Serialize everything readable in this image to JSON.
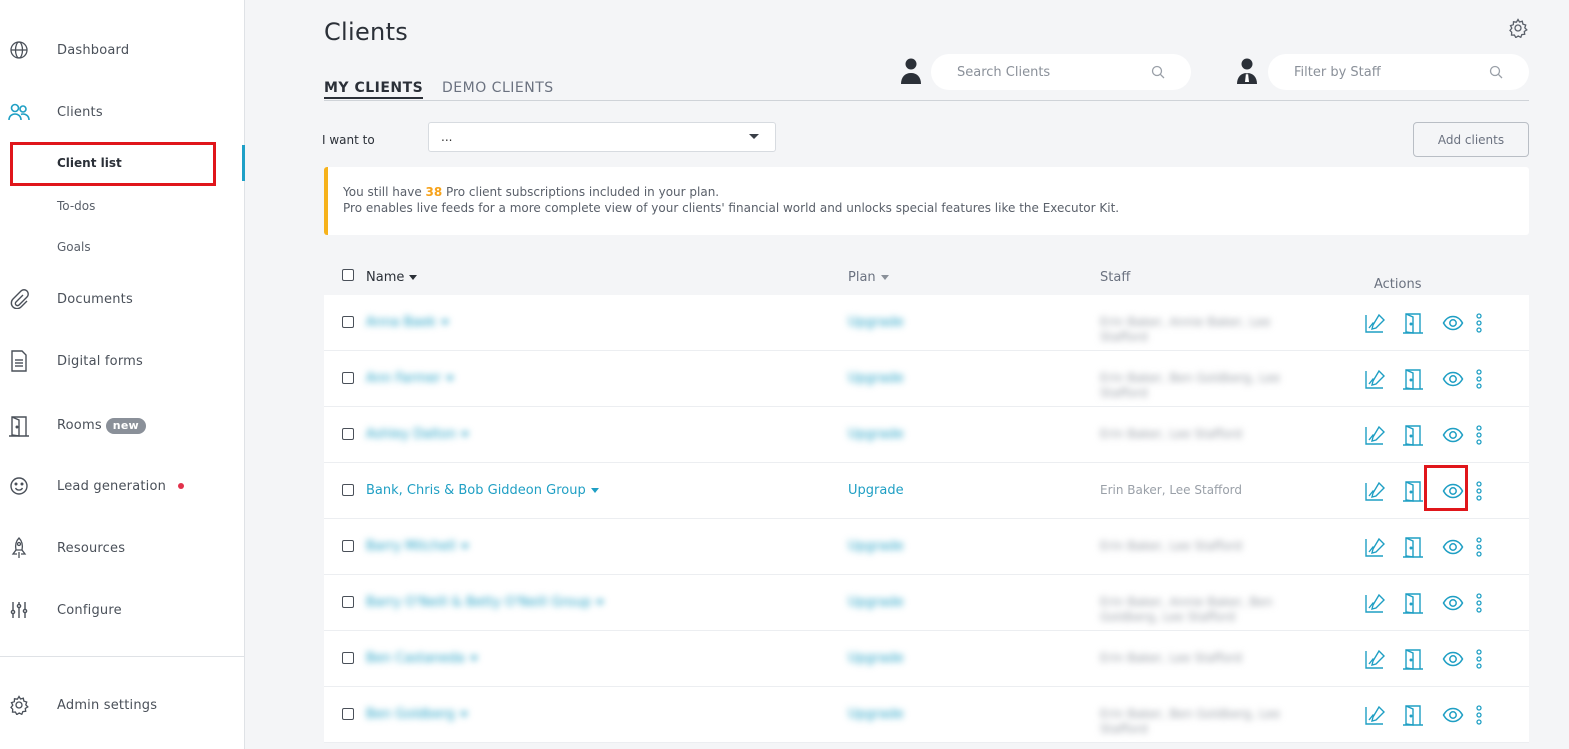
{
  "sidebar": {
    "items": [
      {
        "label": "Dashboard",
        "icon": "globe-icon"
      },
      {
        "label": "Clients",
        "icon": "users-icon"
      },
      {
        "label": "Documents",
        "icon": "paperclip-icon"
      },
      {
        "label": "Digital forms",
        "icon": "document-icon"
      },
      {
        "label": "Rooms",
        "icon": "door-icon",
        "badge": "new"
      },
      {
        "label": "Lead generation",
        "icon": "smiley-icon"
      },
      {
        "label": "Resources",
        "icon": "rocket-icon"
      },
      {
        "label": "Configure",
        "icon": "sliders-icon"
      },
      {
        "label": "Admin settings",
        "icon": "gear-icon"
      }
    ],
    "sub_items": [
      {
        "label": "Client list",
        "active": true
      },
      {
        "label": "To-dos"
      },
      {
        "label": "Goals"
      }
    ]
  },
  "header": {
    "title": "Clients",
    "tabs": [
      {
        "label": "MY CLIENTS",
        "active": true
      },
      {
        "label": "DEMO CLIENTS",
        "active": false
      }
    ],
    "search_placeholder": "Search Clients",
    "staff_placeholder": "Filter by Staff"
  },
  "toolbar": {
    "iwant_label": "I want to",
    "select_value": "...",
    "add_clients_label": "Add clients"
  },
  "notice": {
    "line1_prefix": "You still have ",
    "count": "38",
    "line1_suffix": " Pro client subscriptions included in your plan.",
    "line2": "Pro enables live feeds for a more complete view of your clients' financial world and unlocks special features like the Executor Kit."
  },
  "table": {
    "headers": {
      "name": "Name",
      "plan": "Plan",
      "staff": "Staff",
      "actions": "Actions"
    },
    "rows": [
      {
        "name": "Anna Baek",
        "plan": "Upgrade",
        "staff": "Erin Baker, Annie Baker, Lee Stafford",
        "blurred": true
      },
      {
        "name": "Ann Farmer",
        "plan": "Upgrade",
        "staff": "Erin Baker, Ben Goldberg, Lee Stafford",
        "blurred": true
      },
      {
        "name": "Ashley Dalton",
        "plan": "Upgrade",
        "staff": "Erin Baker, Lee Stafford",
        "blurred": true
      },
      {
        "name": "Bank, Chris & Bob Giddeon Group",
        "plan": "Upgrade",
        "staff": "Erin Baker, Lee Stafford",
        "blurred": false
      },
      {
        "name": "Barry Mitchell",
        "plan": "Upgrade",
        "staff": "Erin Baker, Lee Stafford",
        "blurred": true
      },
      {
        "name": "Barry O'Neill & Betty O'Neill Group",
        "plan": "Upgrade",
        "staff": "Erin Baker, Annie Baker, Ben Goldberg, Lee Stafford",
        "blurred": true
      },
      {
        "name": "Ben Castaneda",
        "plan": "Upgrade",
        "staff": "Erin Baker, Lee Stafford",
        "blurred": true
      },
      {
        "name": "Ben Goldberg",
        "plan": "Upgrade",
        "staff": "Erin Baker, Ben Goldberg, Lee Stafford",
        "blurred": true
      }
    ]
  },
  "colors": {
    "accent": "#1f9fc4",
    "highlight": "#e0161b",
    "notice_bar": "#f6b21b"
  }
}
